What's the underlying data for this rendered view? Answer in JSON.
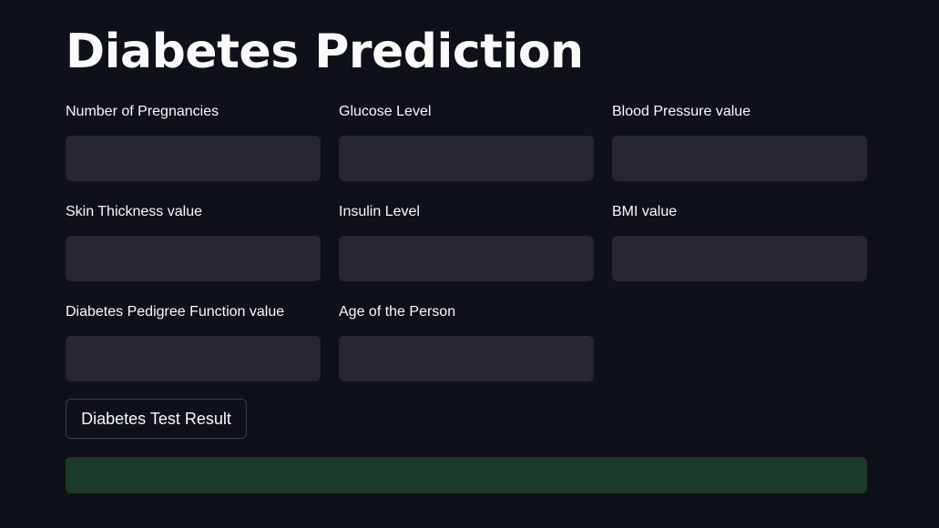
{
  "header": {
    "title": "Diabetes Prediction"
  },
  "form": {
    "fields": [
      {
        "label": "Number of Pregnancies",
        "value": ""
      },
      {
        "label": "Glucose Level",
        "value": ""
      },
      {
        "label": "Blood Pressure value",
        "value": ""
      },
      {
        "label": "Skin Thickness value",
        "value": ""
      },
      {
        "label": "Insulin Level",
        "value": ""
      },
      {
        "label": "BMI value",
        "value": ""
      },
      {
        "label": "Diabetes Pedigree Function value",
        "value": ""
      },
      {
        "label": "Age of the Person",
        "value": ""
      }
    ],
    "submit_label": "Diabetes Test Result"
  },
  "result": {
    "text": "",
    "color": "#1b3a2a"
  },
  "colors": {
    "background": "#0e1117",
    "input_background": "#262730",
    "text": "#fafafa"
  }
}
